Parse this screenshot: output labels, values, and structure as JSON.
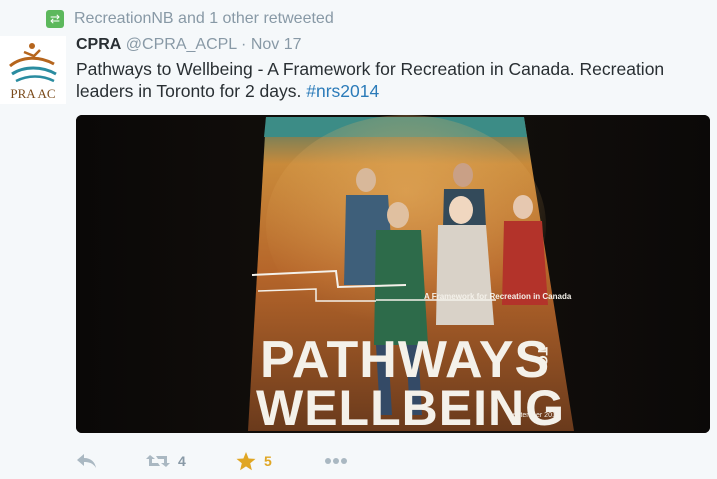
{
  "context": {
    "retweeted_by": "RecreationNB and 1 other retweeted",
    "icon": "retweet-icon"
  },
  "author": {
    "name": "CPRA",
    "handle": "@CPRA_ACPL",
    "separator": "·",
    "time": "Nov 17",
    "avatar_text": "PRA AC"
  },
  "tweet": {
    "text": "Pathways to Wellbeing - A Framework for Recreation in Canada. Recreation leaders in Toronto for 2 days. ",
    "hashtag": "#nrs2014"
  },
  "media": {
    "cover_subtitle": "A Framework for Recreation in Canada",
    "cover_title_line1": "PATHWAYS",
    "cover_title_to": "TO",
    "cover_title_line2": "WELLBEING",
    "cover_date": "September 2014"
  },
  "actions": {
    "reply_icon": "reply-icon",
    "retweet_icon": "retweet-icon",
    "retweet_count": "4",
    "favorite_icon": "star-icon",
    "favorite_count": "5",
    "more_icon": "more-icon"
  },
  "colors": {
    "link": "#2b7bb9",
    "muted": "#8899a6",
    "favorite": "#e0a624",
    "retweet_badge": "#5cb85c"
  }
}
